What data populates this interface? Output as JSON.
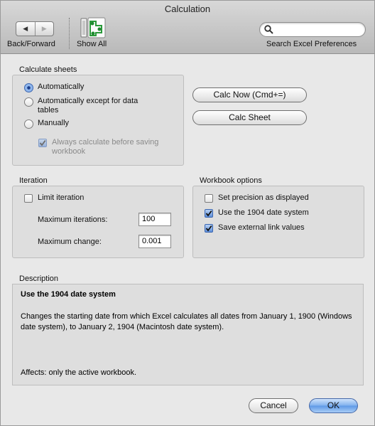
{
  "window": {
    "title": "Calculation"
  },
  "toolbar": {
    "back_forward_label": "Back/Forward",
    "show_all_label": "Show All",
    "search_label": "Search Excel Preferences",
    "search_value": ""
  },
  "calculate_sheets": {
    "title": "Calculate sheets",
    "options": [
      {
        "label": "Automatically",
        "selected": true
      },
      {
        "label": "Automatically except for data tables",
        "selected": false
      },
      {
        "label": "Manually",
        "selected": false
      }
    ],
    "always_calc_label": "Always calculate before saving workbook",
    "always_calc_checked": true,
    "always_calc_enabled": false
  },
  "buttons": {
    "calc_now": "Calc Now (Cmd+=)",
    "calc_sheet": "Calc Sheet",
    "cancel": "Cancel",
    "ok": "OK"
  },
  "iteration": {
    "title": "Iteration",
    "limit_label": "Limit iteration",
    "limit_checked": false,
    "max_iterations_label": "Maximum iterations:",
    "max_iterations_value": "100",
    "max_change_label": "Maximum change:",
    "max_change_value": "0.001"
  },
  "workbook_options": {
    "title": "Workbook options",
    "items": [
      {
        "label": "Set precision as displayed",
        "checked": false
      },
      {
        "label": "Use the 1904 date system",
        "checked": true
      },
      {
        "label": "Save external link values",
        "checked": true
      }
    ]
  },
  "description": {
    "title": "Description",
    "heading": "Use the 1904 date system",
    "text": "Changes the starting date from which Excel calculates all dates from January 1, 1900 (Windows date system), to January 2, 1904 (Macintosh date system).",
    "affects": "Affects: only the active workbook."
  },
  "colors": {
    "accent": "#5d98e6",
    "window_bg": "#e8e8e8",
    "group_bg": "#dedede"
  }
}
